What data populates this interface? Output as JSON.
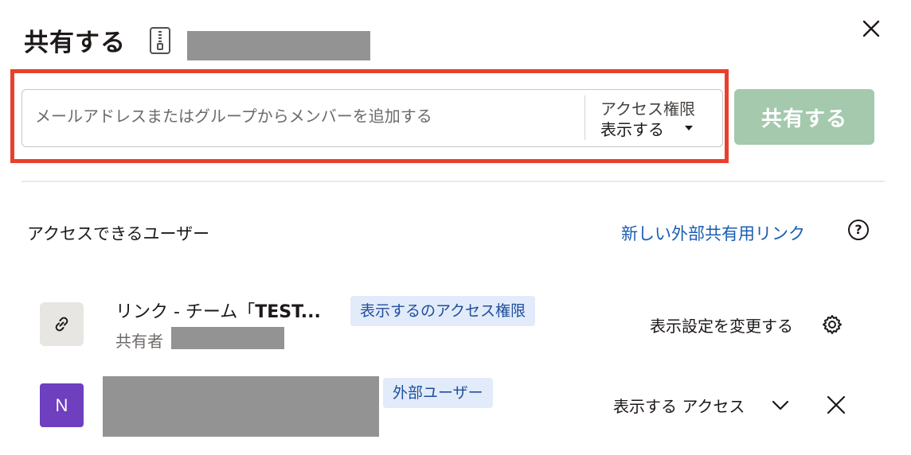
{
  "header": {
    "title": "共有する",
    "file_icon": "zip-file-icon",
    "close_icon": "close-icon"
  },
  "share_form": {
    "placeholder": "メールアドレスまたはグループからメンバーを追加する",
    "access_label": "アクセス権限",
    "access_value": "表示する",
    "share_button": "共有する"
  },
  "access_section": {
    "heading": "アクセスできるユーザー",
    "new_link": "新しい外部共有用リンク",
    "help_icon_text": "?"
  },
  "link_row": {
    "name_prefix": "リンク - チーム「",
    "name_bold": "TEST...",
    "badge": "表示するのアクセス権限",
    "sharer_label": "共有者",
    "settings_action": "表示設定を変更する"
  },
  "user_row": {
    "avatar_initial": "N",
    "badge": "外部ユーザー",
    "access": "表示する アクセス"
  },
  "colors": {
    "highlight": "#e8402c",
    "share_button": "#a4c9ad",
    "link": "#1a5db3",
    "badge_bg": "#e2ebfa",
    "avatar": "#6e3fbf",
    "redaction": "#939393"
  }
}
